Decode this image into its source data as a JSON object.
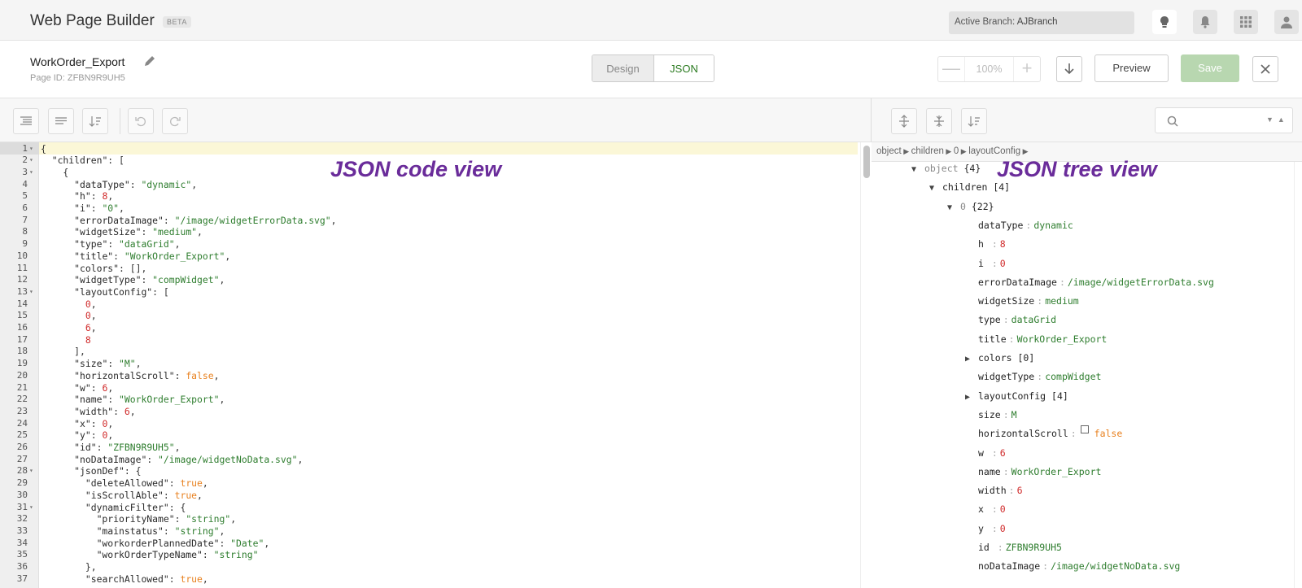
{
  "app": {
    "title": "Web Page Builder",
    "badge": "BETA"
  },
  "branch": {
    "label": "Active Branch:",
    "value": "AJBranch"
  },
  "page": {
    "name": "WorkOrder_Export",
    "id_text": "Page ID: ZFBN9R9UH5"
  },
  "view_tabs": {
    "design": "Design",
    "json": "JSON",
    "active": "JSON"
  },
  "zoom": {
    "minus": "—",
    "value": "100%",
    "plus": "+"
  },
  "actions": {
    "preview": "Preview",
    "save": "Save"
  },
  "colors": {
    "accent_green": "#2a7a1f",
    "save_disabled": "#b8d7b0",
    "annotation_purple": "#6a2c9a",
    "string": "#2e7d2e",
    "number": "#d02b2b",
    "boolean": "#e8811f"
  },
  "annotations": {
    "code_view": "JSON code view",
    "tree_view": "JSON tree view"
  },
  "breadcrumb": [
    "object",
    "children",
    "0",
    "layoutConfig"
  ],
  "code_lines": [
    [
      {
        "t": "p",
        "v": "{"
      }
    ],
    [
      {
        "t": "p",
        "v": "  "
      },
      {
        "t": "k",
        "v": "\"children\""
      },
      {
        "t": "p",
        "v": ": ["
      }
    ],
    [
      {
        "t": "p",
        "v": "    {"
      }
    ],
    [
      {
        "t": "p",
        "v": "      "
      },
      {
        "t": "k",
        "v": "\"dataType\""
      },
      {
        "t": "p",
        "v": ": "
      },
      {
        "t": "s",
        "v": "\"dynamic\""
      },
      {
        "t": "p",
        "v": ","
      }
    ],
    [
      {
        "t": "p",
        "v": "      "
      },
      {
        "t": "k",
        "v": "\"h\""
      },
      {
        "t": "p",
        "v": ": "
      },
      {
        "t": "n",
        "v": "8"
      },
      {
        "t": "p",
        "v": ","
      }
    ],
    [
      {
        "t": "p",
        "v": "      "
      },
      {
        "t": "k",
        "v": "\"i\""
      },
      {
        "t": "p",
        "v": ": "
      },
      {
        "t": "s",
        "v": "\"0\""
      },
      {
        "t": "p",
        "v": ","
      }
    ],
    [
      {
        "t": "p",
        "v": "      "
      },
      {
        "t": "k",
        "v": "\"errorDataImage\""
      },
      {
        "t": "p",
        "v": ": "
      },
      {
        "t": "s",
        "v": "\"/image/widgetErrorData.svg\""
      },
      {
        "t": "p",
        "v": ","
      }
    ],
    [
      {
        "t": "p",
        "v": "      "
      },
      {
        "t": "k",
        "v": "\"widgetSize\""
      },
      {
        "t": "p",
        "v": ": "
      },
      {
        "t": "s",
        "v": "\"medium\""
      },
      {
        "t": "p",
        "v": ","
      }
    ],
    [
      {
        "t": "p",
        "v": "      "
      },
      {
        "t": "k",
        "v": "\"type\""
      },
      {
        "t": "p",
        "v": ": "
      },
      {
        "t": "s",
        "v": "\"dataGrid\""
      },
      {
        "t": "p",
        "v": ","
      }
    ],
    [
      {
        "t": "p",
        "v": "      "
      },
      {
        "t": "k",
        "v": "\"title\""
      },
      {
        "t": "p",
        "v": ": "
      },
      {
        "t": "s",
        "v": "\"WorkOrder_Export\""
      },
      {
        "t": "p",
        "v": ","
      }
    ],
    [
      {
        "t": "p",
        "v": "      "
      },
      {
        "t": "k",
        "v": "\"colors\""
      },
      {
        "t": "p",
        "v": ": [],"
      }
    ],
    [
      {
        "t": "p",
        "v": "      "
      },
      {
        "t": "k",
        "v": "\"widgetType\""
      },
      {
        "t": "p",
        "v": ": "
      },
      {
        "t": "s",
        "v": "\"compWidget\""
      },
      {
        "t": "p",
        "v": ","
      }
    ],
    [
      {
        "t": "p",
        "v": "      "
      },
      {
        "t": "k",
        "v": "\"layoutConfig\""
      },
      {
        "t": "p",
        "v": ": ["
      }
    ],
    [
      {
        "t": "p",
        "v": "        "
      },
      {
        "t": "n",
        "v": "0"
      },
      {
        "t": "p",
        "v": ","
      }
    ],
    [
      {
        "t": "p",
        "v": "        "
      },
      {
        "t": "n",
        "v": "0"
      },
      {
        "t": "p",
        "v": ","
      }
    ],
    [
      {
        "t": "p",
        "v": "        "
      },
      {
        "t": "n",
        "v": "6"
      },
      {
        "t": "p",
        "v": ","
      }
    ],
    [
      {
        "t": "p",
        "v": "        "
      },
      {
        "t": "n",
        "v": "8"
      }
    ],
    [
      {
        "t": "p",
        "v": "      ],"
      }
    ],
    [
      {
        "t": "p",
        "v": "      "
      },
      {
        "t": "k",
        "v": "\"size\""
      },
      {
        "t": "p",
        "v": ": "
      },
      {
        "t": "s",
        "v": "\"M\""
      },
      {
        "t": "p",
        "v": ","
      }
    ],
    [
      {
        "t": "p",
        "v": "      "
      },
      {
        "t": "k",
        "v": "\"horizontalScroll\""
      },
      {
        "t": "p",
        "v": ": "
      },
      {
        "t": "b",
        "v": "false"
      },
      {
        "t": "p",
        "v": ","
      }
    ],
    [
      {
        "t": "p",
        "v": "      "
      },
      {
        "t": "k",
        "v": "\"w\""
      },
      {
        "t": "p",
        "v": ": "
      },
      {
        "t": "n",
        "v": "6"
      },
      {
        "t": "p",
        "v": ","
      }
    ],
    [
      {
        "t": "p",
        "v": "      "
      },
      {
        "t": "k",
        "v": "\"name\""
      },
      {
        "t": "p",
        "v": ": "
      },
      {
        "t": "s",
        "v": "\"WorkOrder_Export\""
      },
      {
        "t": "p",
        "v": ","
      }
    ],
    [
      {
        "t": "p",
        "v": "      "
      },
      {
        "t": "k",
        "v": "\"width\""
      },
      {
        "t": "p",
        "v": ": "
      },
      {
        "t": "n",
        "v": "6"
      },
      {
        "t": "p",
        "v": ","
      }
    ],
    [
      {
        "t": "p",
        "v": "      "
      },
      {
        "t": "k",
        "v": "\"x\""
      },
      {
        "t": "p",
        "v": ": "
      },
      {
        "t": "n",
        "v": "0"
      },
      {
        "t": "p",
        "v": ","
      }
    ],
    [
      {
        "t": "p",
        "v": "      "
      },
      {
        "t": "k",
        "v": "\"y\""
      },
      {
        "t": "p",
        "v": ": "
      },
      {
        "t": "n",
        "v": "0"
      },
      {
        "t": "p",
        "v": ","
      }
    ],
    [
      {
        "t": "p",
        "v": "      "
      },
      {
        "t": "k",
        "v": "\"id\""
      },
      {
        "t": "p",
        "v": ": "
      },
      {
        "t": "s",
        "v": "\"ZFBN9R9UH5\""
      },
      {
        "t": "p",
        "v": ","
      }
    ],
    [
      {
        "t": "p",
        "v": "      "
      },
      {
        "t": "k",
        "v": "\"noDataImage\""
      },
      {
        "t": "p",
        "v": ": "
      },
      {
        "t": "s",
        "v": "\"/image/widgetNoData.svg\""
      },
      {
        "t": "p",
        "v": ","
      }
    ],
    [
      {
        "t": "p",
        "v": "      "
      },
      {
        "t": "k",
        "v": "\"jsonDef\""
      },
      {
        "t": "p",
        "v": ": {"
      }
    ],
    [
      {
        "t": "p",
        "v": "        "
      },
      {
        "t": "k",
        "v": "\"deleteAllowed\""
      },
      {
        "t": "p",
        "v": ": "
      },
      {
        "t": "b",
        "v": "true"
      },
      {
        "t": "p",
        "v": ","
      }
    ],
    [
      {
        "t": "p",
        "v": "        "
      },
      {
        "t": "k",
        "v": "\"isScrollAble\""
      },
      {
        "t": "p",
        "v": ": "
      },
      {
        "t": "b",
        "v": "true"
      },
      {
        "t": "p",
        "v": ","
      }
    ],
    [
      {
        "t": "p",
        "v": "        "
      },
      {
        "t": "k",
        "v": "\"dynamicFilter\""
      },
      {
        "t": "p",
        "v": ": {"
      }
    ],
    [
      {
        "t": "p",
        "v": "          "
      },
      {
        "t": "k",
        "v": "\"priorityName\""
      },
      {
        "t": "p",
        "v": ": "
      },
      {
        "t": "s",
        "v": "\"string\""
      },
      {
        "t": "p",
        "v": ","
      }
    ],
    [
      {
        "t": "p",
        "v": "          "
      },
      {
        "t": "k",
        "v": "\"mainstatus\""
      },
      {
        "t": "p",
        "v": ": "
      },
      {
        "t": "s",
        "v": "\"string\""
      },
      {
        "t": "p",
        "v": ","
      }
    ],
    [
      {
        "t": "p",
        "v": "          "
      },
      {
        "t": "k",
        "v": "\"workorderPlannedDate\""
      },
      {
        "t": "p",
        "v": ": "
      },
      {
        "t": "s",
        "v": "\"Date\""
      },
      {
        "t": "p",
        "v": ","
      }
    ],
    [
      {
        "t": "p",
        "v": "          "
      },
      {
        "t": "k",
        "v": "\"workOrderTypeName\""
      },
      {
        "t": "p",
        "v": ": "
      },
      {
        "t": "s",
        "v": "\"string\""
      }
    ],
    [
      {
        "t": "p",
        "v": "        },"
      }
    ],
    [
      {
        "t": "p",
        "v": "        "
      },
      {
        "t": "k",
        "v": "\"searchAllowed\""
      },
      {
        "t": "p",
        "v": ": "
      },
      {
        "t": "b",
        "v": "true"
      },
      {
        "t": "p",
        "v": ","
      }
    ]
  ],
  "fold_lines": [
    1,
    2,
    3,
    13,
    28,
    31
  ],
  "tree": [
    {
      "depth": 0,
      "toggle": "open",
      "key": "object",
      "meta": "{4}",
      "keyClass": "tg"
    },
    {
      "depth": 1,
      "toggle": "open",
      "key": "children",
      "meta": "[4]"
    },
    {
      "depth": 2,
      "toggle": "open",
      "key": "0",
      "meta": "{22}",
      "keyClass": "tg"
    },
    {
      "depth": 3,
      "key": "dataType",
      "value": "dynamic",
      "vt": "s"
    },
    {
      "depth": 3,
      "key": "h",
      "pad": "  ",
      "value": "8",
      "vt": "n"
    },
    {
      "depth": 3,
      "key": "i",
      "pad": "  ",
      "value": "0",
      "vt": "n"
    },
    {
      "depth": 3,
      "key": "errorDataImage",
      "value": "/image/widgetErrorData.svg",
      "vt": "s"
    },
    {
      "depth": 3,
      "key": "widgetSize",
      "value": "medium",
      "vt": "s"
    },
    {
      "depth": 3,
      "key": "type",
      "value": "dataGrid",
      "vt": "s"
    },
    {
      "depth": 3,
      "key": "title",
      "value": "WorkOrder_Export",
      "vt": "s"
    },
    {
      "depth": 3,
      "toggle": "closed",
      "key": "colors",
      "meta": "[0]"
    },
    {
      "depth": 3,
      "key": "widgetType",
      "value": "compWidget",
      "vt": "s"
    },
    {
      "depth": 3,
      "toggle": "closed",
      "key": "layoutConfig",
      "meta": "[4]"
    },
    {
      "depth": 3,
      "key": "size",
      "value": "M",
      "vt": "s"
    },
    {
      "depth": 3,
      "key": "horizontalScroll",
      "value": "false",
      "vt": "b",
      "checkbox": true
    },
    {
      "depth": 3,
      "key": "w",
      "pad": "  ",
      "value": "6",
      "vt": "n"
    },
    {
      "depth": 3,
      "key": "name",
      "value": "WorkOrder_Export",
      "vt": "s"
    },
    {
      "depth": 3,
      "key": "width",
      "value": "6",
      "vt": "n"
    },
    {
      "depth": 3,
      "key": "x",
      "pad": "  ",
      "value": "0",
      "vt": "n"
    },
    {
      "depth": 3,
      "key": "y",
      "pad": "  ",
      "value": "0",
      "vt": "n"
    },
    {
      "depth": 3,
      "key": "id",
      "pad": " ",
      "value": "ZFBN9R9UH5",
      "vt": "s"
    },
    {
      "depth": 3,
      "key": "noDataImage",
      "value": "/image/widgetNoData.svg",
      "vt": "s"
    }
  ]
}
